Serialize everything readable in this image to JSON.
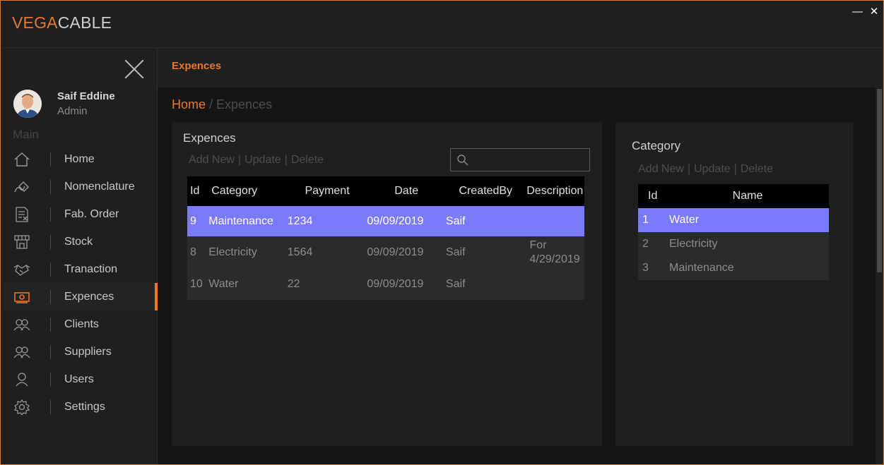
{
  "app": {
    "logo_part1": "VEGA",
    "logo_part2": "CABLE",
    "minimize_glyph": "—",
    "close_glyph": "✕",
    "accent": "#e8782a"
  },
  "sidebar": {
    "user_name": "Saif Eddine",
    "user_role": "Admin",
    "section_label": "Main",
    "items": [
      {
        "label": "Home",
        "icon": "home-icon"
      },
      {
        "label": "Nomenclature",
        "icon": "handwriting-icon"
      },
      {
        "label": "Fab. Order",
        "icon": "order-icon"
      },
      {
        "label": "Stock",
        "icon": "store-icon"
      },
      {
        "label": "Tranaction",
        "icon": "handshake-icon"
      },
      {
        "label": "Expences",
        "icon": "money-icon",
        "active": true
      },
      {
        "label": "Clients",
        "icon": "users-icon"
      },
      {
        "label": "Suppliers",
        "icon": "users-icon"
      },
      {
        "label": "Users",
        "icon": "user-icon"
      },
      {
        "label": "Settings",
        "icon": "gear-icon"
      }
    ]
  },
  "header": {
    "title": "Expences"
  },
  "breadcrumb": {
    "home": "Home",
    "current": " / Expences"
  },
  "expences_panel": {
    "title": "Expences",
    "actions": [
      "Add New",
      "Update",
      "Delete"
    ],
    "search_placeholder": "",
    "columns": [
      "Id",
      "Category",
      "Payment",
      "Date",
      "CreatedBy",
      "Description"
    ],
    "rows": [
      {
        "id": "9",
        "category": "Maintenance",
        "payment": "1234",
        "date": "09/09/2019",
        "created_by": "Saif",
        "description": "",
        "selected": true
      },
      {
        "id": "8",
        "category": "Electricity",
        "payment": "1564",
        "date": "09/09/2019",
        "created_by": "Saif",
        "description": "For 4/29/2019"
      },
      {
        "id": "10",
        "category": "Water",
        "payment": "22",
        "date": "09/09/2019",
        "created_by": "Saif",
        "description": ""
      }
    ]
  },
  "category_panel": {
    "title": "Category",
    "actions": [
      "Add New",
      "Update",
      "Delete"
    ],
    "columns": [
      "Id",
      "Name"
    ],
    "rows": [
      {
        "id": "1",
        "name": "Water",
        "selected": true
      },
      {
        "id": "2",
        "name": "Electricity"
      },
      {
        "id": "3",
        "name": "Maintenance"
      }
    ]
  },
  "colors": {
    "selection": "#7a7aff",
    "muted_action": "#4d4d4d",
    "table_header": "#000000"
  }
}
